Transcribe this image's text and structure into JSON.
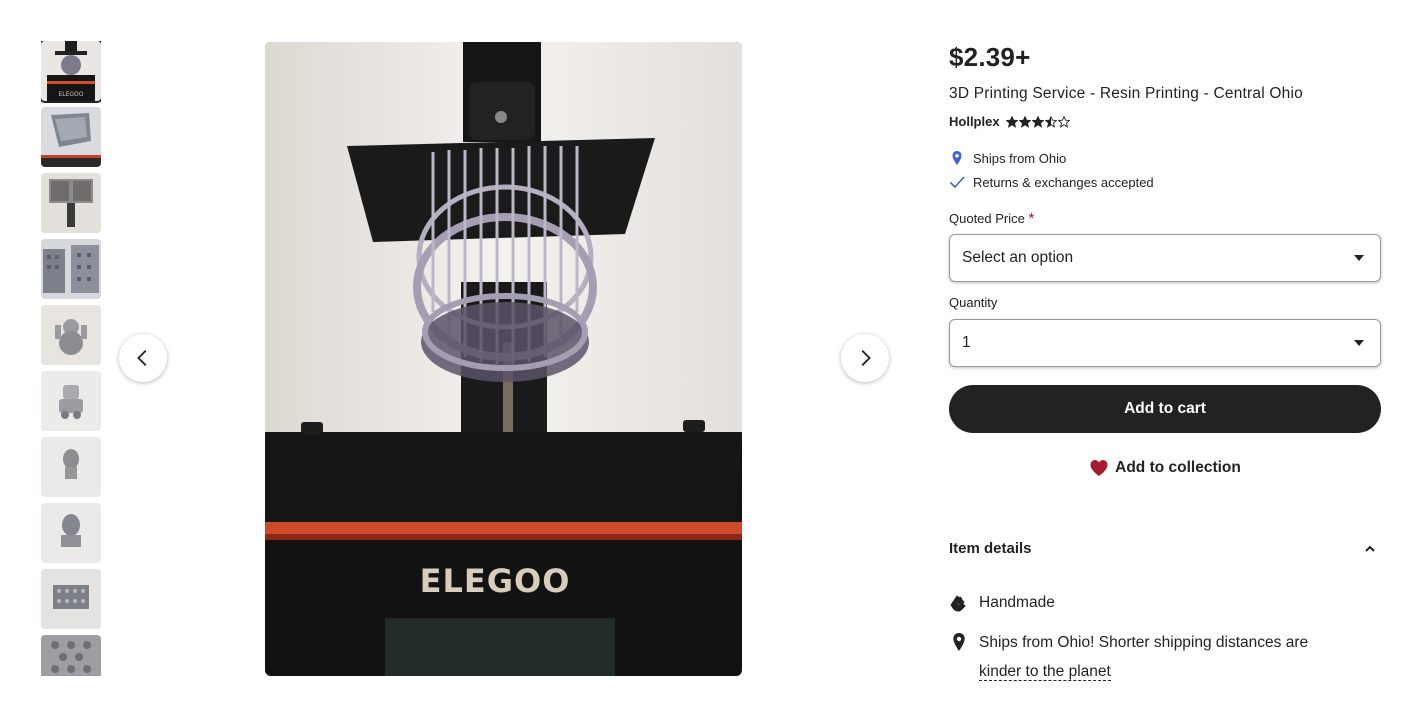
{
  "gallery": {
    "thumbnails": [
      {
        "alt": "printer-photo",
        "selected": true
      },
      {
        "alt": "printed-part-1"
      },
      {
        "alt": "printed-part-2"
      },
      {
        "alt": "printed-building"
      },
      {
        "alt": "printed-figure"
      },
      {
        "alt": "printed-robot"
      },
      {
        "alt": "printed-bust-1"
      },
      {
        "alt": "printed-bust-2"
      },
      {
        "alt": "printed-box"
      },
      {
        "alt": "printed-panel"
      }
    ],
    "main_image_logo": "ELEGOO",
    "prev_icon": "chevron-left-icon",
    "next_icon": "chevron-right-icon"
  },
  "listing": {
    "price": "$2.39+",
    "title": "3D Printing Service - Resin Printing - Central Ohio",
    "shop_name": "Hollplex",
    "rating": 3.5,
    "rating_max": 5,
    "ships_from": "Ships from Ohio",
    "returns": "Returns & exchanges accepted"
  },
  "form": {
    "quoted_price_label": "Quoted Price",
    "required_mark": "*",
    "quoted_price_value": "Select an option",
    "quantity_label": "Quantity",
    "quantity_value": "1",
    "add_to_cart": "Add to cart",
    "add_to_collection": "Add to collection"
  },
  "details": {
    "title": "Item details",
    "handmade": "Handmade",
    "ships_text": "Ships from Ohio! Shorter shipping distances are",
    "ships_link": "kinder to the planet"
  },
  "colors": {
    "text": "#222222",
    "button_dark": "#222222",
    "heart": "#a61a2e",
    "location_pin": "#3d63d6",
    "required": "#a61a2e"
  }
}
